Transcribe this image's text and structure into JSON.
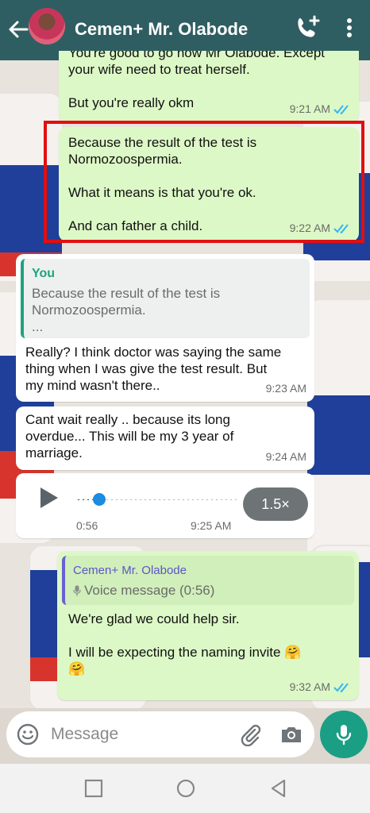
{
  "header": {
    "contact_name": "Cemen+ Mr. Olabode"
  },
  "messages": [
    {
      "type": "outgoing",
      "text": "You're good to go now Mr Olabode. Except\nyour wife need to treat herself.\n\nBut you're really okm",
      "time": "9:21 AM"
    },
    {
      "type": "outgoing",
      "text": "Because the result of the test is\nNormozoospermia.\n\nWhat it means is that you're ok.\n\nAnd can father a child.",
      "time": "9:22 AM"
    },
    {
      "type": "incoming",
      "quote": {
        "author": "You",
        "text": "Because the result of the test is\nNormozoospermia.\n..."
      },
      "text": "Really? I think doctor was saying the same\nthing when I was give the test result. But\nmy mind wasn't there..",
      "time": "9:23 AM"
    },
    {
      "type": "incoming",
      "text": "Cant wait really .. because its long\noverdue... This will be my 3 year of\nmarriage.",
      "time": "9:24 AM"
    },
    {
      "type": "incoming-voice",
      "duration": "0:56",
      "time": "9:25 AM",
      "speed": "1.5×",
      "progress": 0.15
    },
    {
      "type": "outgoing",
      "quote": {
        "author": "Cemen+ Mr. Olabode",
        "text": "Voice message (0:56)"
      },
      "text": "We're glad we could help sir.\n\nI will be expecting the naming invite 🤗\n🤗",
      "time": "9:32 AM"
    }
  ],
  "input": {
    "placeholder": "Message"
  },
  "colors": {
    "header": "#2f5e62",
    "outgoing": "#dcf8c6",
    "accent": "#1a9f84",
    "read_ticks": "#34b7f1",
    "highlight": "#e10f10"
  }
}
